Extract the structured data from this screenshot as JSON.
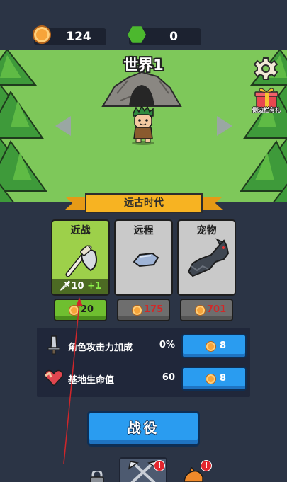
{
  "resources": {
    "coins": "124",
    "gems": "0"
  },
  "world": {
    "title": "世界1",
    "gift_label": "侧边栏有礼"
  },
  "era": {
    "title": "远古时代"
  },
  "cards": [
    {
      "title": "近战",
      "stat_value": "10",
      "stat_bonus": "+1",
      "price": "20",
      "state": "active"
    },
    {
      "title": "远程",
      "price": "175",
      "state": "locked"
    },
    {
      "title": "宠物",
      "price": "701",
      "state": "locked"
    }
  ],
  "stats": [
    {
      "label": "角色攻击力加成",
      "value": "0%",
      "cost": "8",
      "icon": "sword-icon"
    },
    {
      "label": "基地生命值",
      "value": "60",
      "cost": "8",
      "icon": "heart-icon"
    }
  ],
  "campaign": {
    "label": "战役"
  },
  "nav": {
    "alert_weapons": "!",
    "alert_pet": "!"
  },
  "colors": {
    "background": "#2b3445",
    "grass": "#7ec85a",
    "accent_blue": "#2a9cf0",
    "active_card": "#9dd04a",
    "banner": "#f7b322",
    "price_red": "#d12828"
  }
}
